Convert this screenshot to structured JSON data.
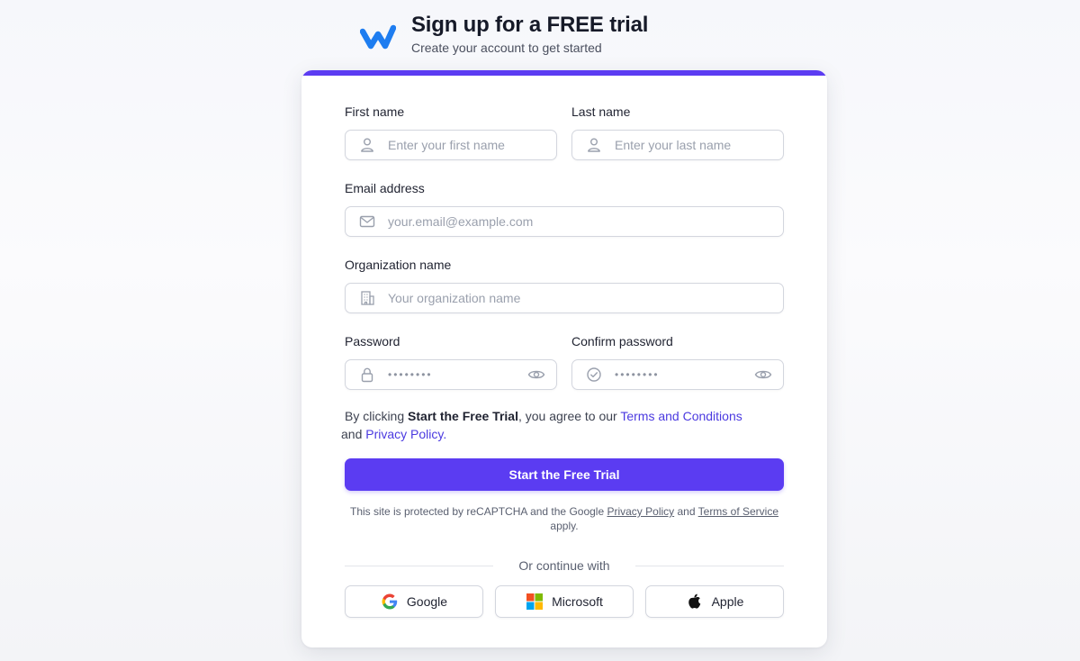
{
  "header": {
    "logo_icon": "w-logo-icon",
    "title": "Sign up for a FREE trial",
    "subtitle": "Create your account to get started"
  },
  "form": {
    "first_name": {
      "label": "First name",
      "placeholder": "Enter your first name",
      "icon": "user-icon"
    },
    "last_name": {
      "label": "Last name",
      "placeholder": "Enter your last name",
      "icon": "user-icon"
    },
    "email": {
      "label": "Email address",
      "placeholder": "your.email@example.com",
      "icon": "mail-icon"
    },
    "organization": {
      "label": "Organization name",
      "placeholder": "Your organization name",
      "icon": "building-icon"
    },
    "password": {
      "label": "Password",
      "value": "••••••••",
      "icon": "lock-icon",
      "toggle_icon": "eye-icon"
    },
    "confirm_password": {
      "label": "Confirm password",
      "value": "••••••••",
      "icon": "check-circle-icon",
      "toggle_icon": "eye-icon"
    }
  },
  "consent": {
    "prefix": "By clicking ",
    "cta_name": "Start the Free Trial",
    "middle": ", you agree to our ",
    "terms_link": "Terms and Conditions",
    "and": " and ",
    "privacy_link": "Privacy Policy."
  },
  "submit_label": "Start the Free Trial",
  "recaptcha": {
    "prefix": "This site is protected by reCAPTCHA and the Google ",
    "privacy_link": "Privacy Policy",
    "and": " and ",
    "terms_link": "Terms of Service",
    "suffix": " apply."
  },
  "divider_text": "Or continue with",
  "social": [
    {
      "label": "Google",
      "icon": "google-icon"
    },
    {
      "label": "Microsoft",
      "icon": "microsoft-icon"
    },
    {
      "label": "Apple",
      "icon": "apple-icon"
    }
  ],
  "colors": {
    "accent": "#5b3cf2",
    "link": "#4b3ae0",
    "logo": "#1e7df0"
  }
}
